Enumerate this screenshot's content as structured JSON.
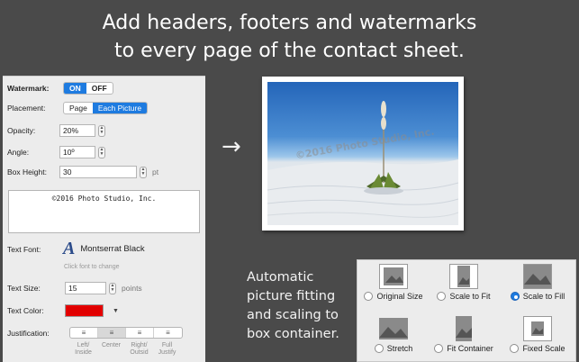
{
  "headline": {
    "line1": "Add headers, footers and watermarks",
    "line2": "to every page of the contact sheet."
  },
  "panel": {
    "watermark": {
      "label": "Watermark:",
      "on": "ON",
      "off": "OFF",
      "selected": "ON"
    },
    "placement": {
      "label": "Placement:",
      "options": [
        "Page",
        "Each Picture"
      ],
      "selected": "Each Picture"
    },
    "opacity": {
      "label": "Opacity:",
      "value": "20%"
    },
    "angle": {
      "label": "Angle:",
      "value": "10º"
    },
    "box_height": {
      "label": "Box Height:",
      "value": "30",
      "unit": "pt"
    },
    "watermark_text": "©2016 Photo Studio, Inc.",
    "text_font": {
      "label": "Text Font:",
      "glyph": "A",
      "name": "Montserrat Black",
      "hint": "Click font to change"
    },
    "text_size": {
      "label": "Text Size:",
      "value": "15",
      "unit": "points"
    },
    "text_color": {
      "label": "Text Color:",
      "color": "#e00000"
    },
    "justification": {
      "label": "Justification:",
      "options": [
        "Left/ Inside",
        "Center",
        "Right/ Outsid",
        "Full Justify"
      ],
      "labels": [
        [
          "Left/",
          "Inside"
        ],
        [
          "Center",
          ""
        ],
        [
          "Right/",
          "Outsid"
        ],
        [
          "Full",
          "Justify"
        ]
      ],
      "selected": "Center"
    }
  },
  "arrow": "→",
  "photo": {
    "watermark_text": "©2016 Photo Studio, Inc."
  },
  "caption": [
    "Automatic",
    "picture fitting",
    "and scaling to",
    "box container."
  ],
  "scaling_options": [
    {
      "label": "Original Size",
      "checked": false
    },
    {
      "label": "Scale to Fit",
      "checked": false
    },
    {
      "label": "Scale to Fill",
      "checked": true
    },
    {
      "label": "Stretch",
      "checked": false
    },
    {
      "label": "Fit Container",
      "checked": false
    },
    {
      "label": "Fixed Scale",
      "checked": false
    }
  ],
  "colors": {
    "accent": "#1e7be0",
    "background": "#4a4a4a",
    "panel": "#ececec"
  }
}
